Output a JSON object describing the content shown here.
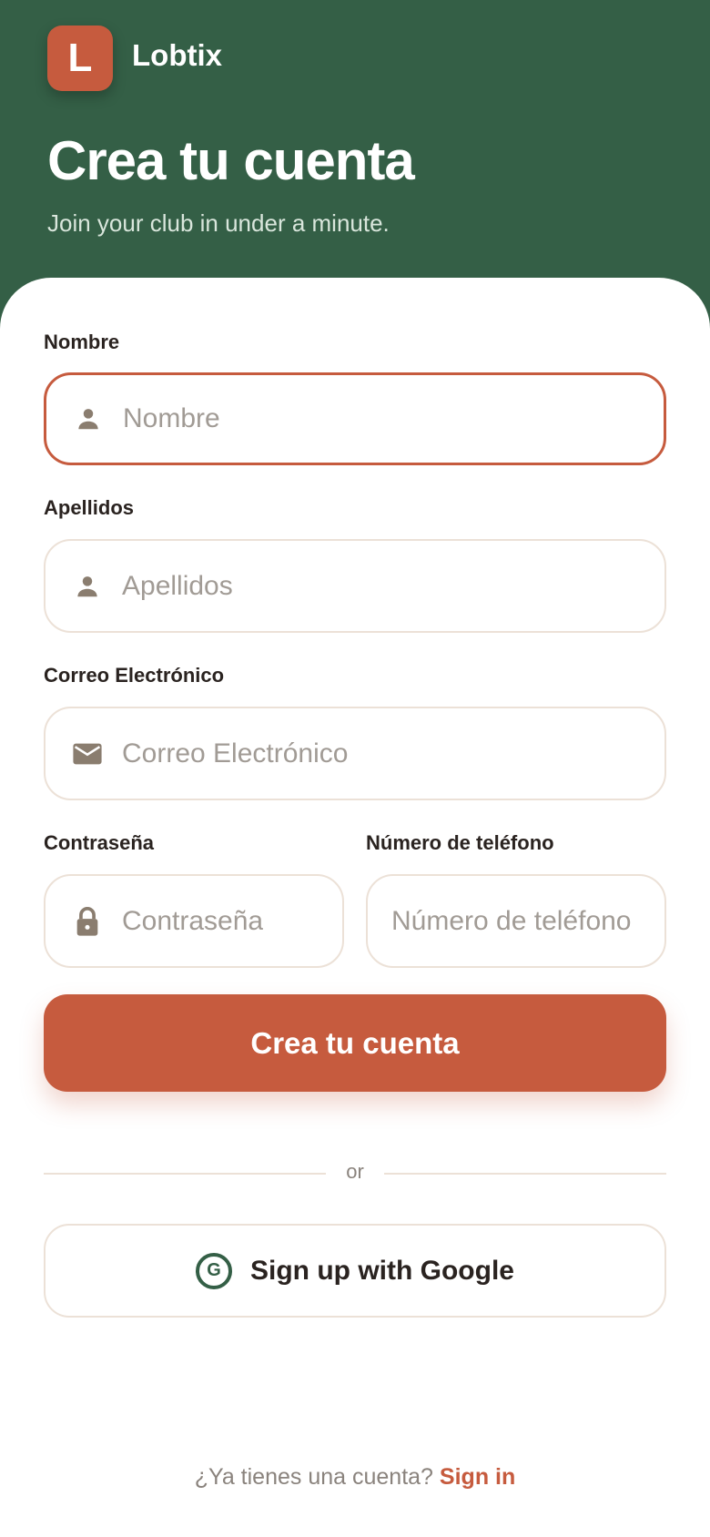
{
  "brand": {
    "logo_letter": "L",
    "name": "Lobtix"
  },
  "header": {
    "title": "Crea tu cuenta",
    "subtitle": "Join your club in under a minute."
  },
  "form": {
    "first_name": {
      "label": "Nombre",
      "placeholder": "Nombre",
      "icon": "person-icon"
    },
    "last_name": {
      "label": "Apellidos",
      "placeholder": "Apellidos",
      "icon": "person-icon"
    },
    "email": {
      "label": "Correo Electrónico",
      "placeholder": "Correo Electrónico",
      "icon": "mail-icon"
    },
    "password": {
      "label": "Contraseña",
      "placeholder": "Contraseña",
      "icon": "lock-icon"
    },
    "phone": {
      "label": "Número de teléfono",
      "placeholder": "Número de teléfono"
    },
    "submit_label": "Crea tu cuenta"
  },
  "divider": {
    "text": "or"
  },
  "google": {
    "label": "Sign up with Google",
    "icon": "google-icon"
  },
  "footer": {
    "prompt": "¿Ya tienes una cuenta?",
    "link": "Sign in"
  },
  "colors": {
    "header_bg": "#345f46",
    "accent": "#c65b3e",
    "border": "#ece1d7",
    "placeholder": "#a19b95"
  }
}
